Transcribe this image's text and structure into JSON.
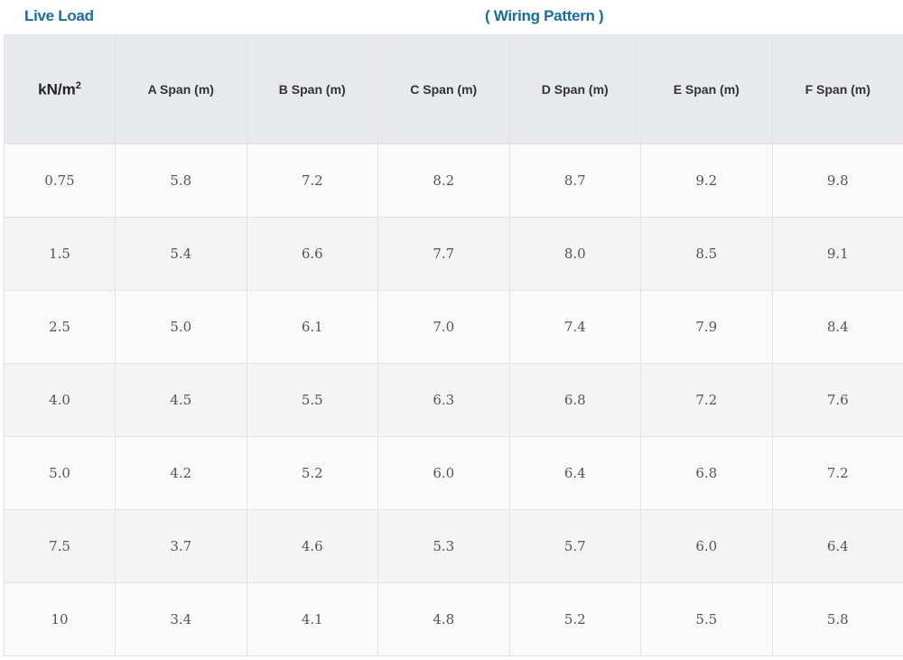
{
  "header": {
    "live_load_label": "Live Load",
    "pattern_label": "( Wiring Pattern )"
  },
  "table": {
    "unit_base": "kN/m",
    "unit_exponent": "2",
    "columns": [
      "A Span (m)",
      "B Span (m)",
      "C Span (m)",
      "D Span (m)",
      "E Span (m)",
      "F Span (m)"
    ],
    "rows": [
      [
        "0.75",
        "5.8",
        "7.2",
        "8.2",
        "8.7",
        "9.2",
        "9.8"
      ],
      [
        "1.5",
        "5.4",
        "6.6",
        "7.7",
        "8.0",
        "8.5",
        "9.1"
      ],
      [
        "2.5",
        "5.0",
        "6.1",
        "7.0",
        "7.4",
        "7.9",
        "8.4"
      ],
      [
        "4.0",
        "4.5",
        "5.5",
        "6.3",
        "6.8",
        "7.2",
        "7.6"
      ],
      [
        "5.0",
        "4.2",
        "5.2",
        "6.0",
        "6.4",
        "6.8",
        "7.2"
      ],
      [
        "7.5",
        "3.7",
        "4.6",
        "5.3",
        "5.7",
        "6.0",
        "6.4"
      ],
      [
        "10",
        "3.4",
        "4.1",
        "4.8",
        "5.2",
        "5.5",
        "5.8"
      ]
    ]
  }
}
